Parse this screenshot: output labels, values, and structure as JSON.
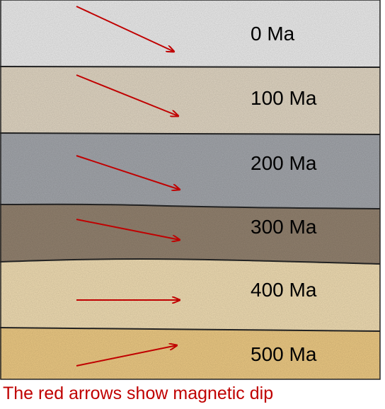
{
  "layers": [
    {
      "age_label": "0 Ma",
      "color": "#ebebeb",
      "arrow_dir": "dipping-down"
    },
    {
      "age_label": "100 Ma",
      "color": "#e0d5c2",
      "arrow_dir": "dipping-down"
    },
    {
      "age_label": "200 Ma",
      "color": "#a3a6ab",
      "arrow_dir": "dipping-down"
    },
    {
      "age_label": "300 Ma",
      "color": "#938270",
      "arrow_dir": "dipping-down"
    },
    {
      "age_label": "400 Ma",
      "color": "#efdcb2",
      "arrow_dir": "horizontal"
    },
    {
      "age_label": "500 Ma",
      "color": "#ecc984",
      "arrow_dir": "dipping-up"
    }
  ],
  "colors": {
    "arrow": "#c00000",
    "boundary": "#222222",
    "caption": "#c00000"
  },
  "caption": "The red arrows show magnetic dip"
}
